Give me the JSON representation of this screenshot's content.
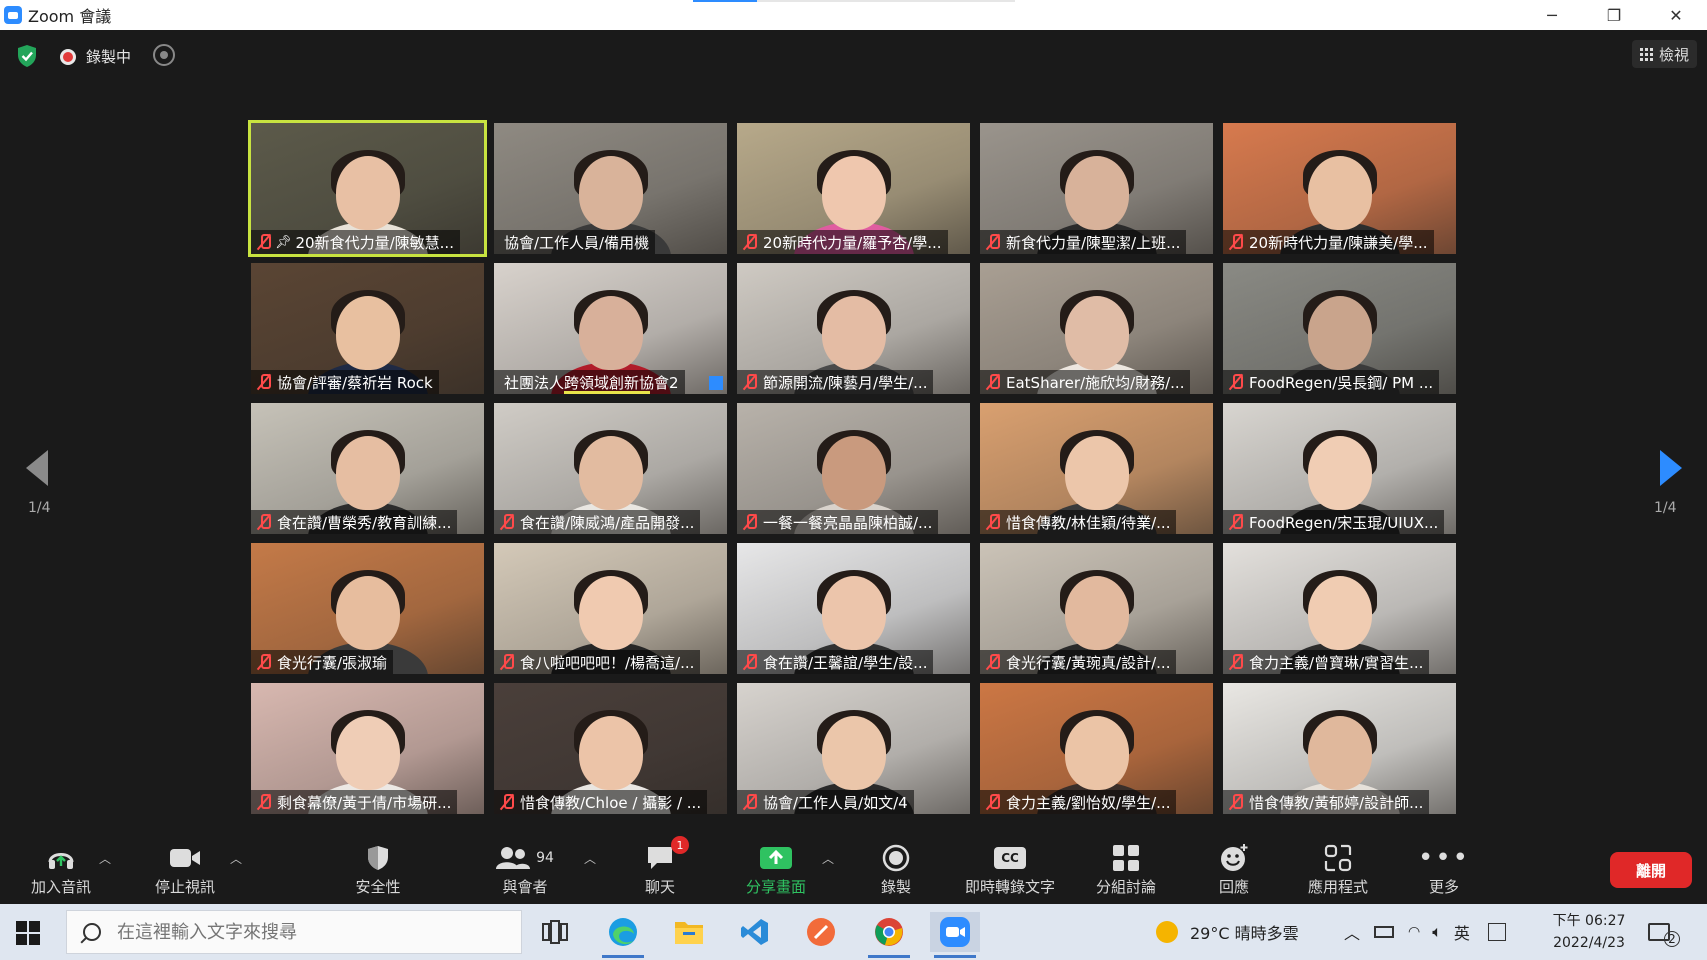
{
  "window": {
    "title": "Zoom 會議",
    "minimize": "─",
    "restore": "❐",
    "close": "✕"
  },
  "topbar": {
    "recording_label": "錄製中",
    "view_label": "檢視"
  },
  "gallery": {
    "page_left": "1/4",
    "page_right": "1/4",
    "tiles": [
      {
        "name": "20新食代力量/陳敏慧...",
        "bg": "#5c5a4a",
        "skin": "#e8c0a4",
        "shirt": "#e8e2d8"
      },
      {
        "name": "協會/工作人員/備用機",
        "bg": "#8f8a82",
        "skin": "#d9b39a",
        "shirt": "#3a3a3a"
      },
      {
        "name": "20新時代力量/羅予杏/學...",
        "bg": "#b7a98a",
        "skin": "#efc7ae",
        "shirt": "#e05ca0"
      },
      {
        "name": "新食代力量/陳聖潔/上班...",
        "bg": "#9a948c",
        "skin": "#d8b29a",
        "shirt": "#2b2b2b"
      },
      {
        "name": "20新時代力量/陳謙美/學...",
        "bg": "#d77a4e",
        "skin": "#e8c0a2",
        "shirt": "#2d2d2d"
      },
      {
        "name": "協會/評審/蔡祈岩 Rock",
        "bg": "#5a4534",
        "skin": "#e8c0a0",
        "shirt": "#1f2a44"
      },
      {
        "name": "社團法人跨領域創新協會2",
        "bg": "#d8d2cc",
        "skin": "#d8b09a",
        "shirt": "#b01c2a"
      },
      {
        "name": "節源開流/陳藝月/學生/...",
        "bg": "#cfcac3",
        "skin": "#e4bca4",
        "shirt": "#4a4a4a"
      },
      {
        "name": "EatSharer/施欣均/財務/...",
        "bg": "#a99f93",
        "skin": "#e0bca6",
        "shirt": "#ece6df"
      },
      {
        "name": "FoodRegen/吳長鋼/ PM ...",
        "bg": "#8a8a84",
        "skin": "#c9a48c",
        "shirt": "#3b3b3b"
      },
      {
        "name": "食在讚/曹榮秀/教育訓練...",
        "bg": "#c6c2b8",
        "skin": "#e6bea2",
        "shirt": "#2c2c2c"
      },
      {
        "name": "食在讚/陳威鴻/產品開發...",
        "bg": "#d0ccc6",
        "skin": "#e2bba0",
        "shirt": "#e9e6e1"
      },
      {
        "name": "一餐一餐亮晶晶陳柏誠/...",
        "bg": "#b8b2aa",
        "skin": "#c99a7e",
        "shirt": "#d9d3cc"
      },
      {
        "name": "惜食傳教/林佳穎/待業/...",
        "bg": "#d9a070",
        "skin": "#ecc6aa",
        "shirt": "#3a3a3a"
      },
      {
        "name": "FoodRegen/宋玉琨/UIUX...",
        "bg": "#d8d5d0",
        "skin": "#f0cdb4",
        "shirt": "#2b2b2b"
      },
      {
        "name": "食光行囊/張淑瑜",
        "bg": "#c47a48",
        "skin": "#e7bd9e",
        "shirt": "#3a3a3a"
      },
      {
        "name": "食八啦吧吧吧！/楊喬這/...",
        "bg": "#d4c9b8",
        "skin": "#f0cab0",
        "shirt": "#262626"
      },
      {
        "name": "食在讚/王馨誼/學生/設...",
        "bg": "#e7e7e8",
        "skin": "#ecc5ab",
        "shirt": "#303030"
      },
      {
        "name": "食光行囊/黃琬真/設計/...",
        "bg": "#cbc3b7",
        "skin": "#e2b99e",
        "shirt": "#2a2a2a"
      },
      {
        "name": "食力主義/曾寶琳/實習生...",
        "bg": "#e3e0dc",
        "skin": "#f0ccb2",
        "shirt": "#2c2c2c"
      },
      {
        "name": "剩食幕僚/黃于倩/市場研...",
        "bg": "#d8b8b0",
        "skin": "#efcdb6",
        "shirt": "#ece8e4"
      },
      {
        "name": "惜食傳教/Chloe / 攝影 / ...",
        "bg": "#4a3f3a",
        "skin": "#ecc4a8",
        "shirt": "#e9e6e2"
      },
      {
        "name": "協會/工作人員/如文/4",
        "bg": "#d7d3ce",
        "skin": "#ebc6aa",
        "shirt": "#2a2a2a"
      },
      {
        "name": "食力主義/劉怡奴/學生/...",
        "bg": "#cc7744",
        "skin": "#ebc4a6",
        "shirt": "#3a2f2a"
      },
      {
        "name": "惜食傳教/黃郁婷/設計師...",
        "bg": "#e9e7e3",
        "skin": "#e0b89c",
        "shirt": "#e6e1da"
      }
    ]
  },
  "toolbar": {
    "audio": "加入音訊",
    "video": "停止視訊",
    "security": "安全性",
    "participants": "與會者",
    "participant_count": "94",
    "chat": "聊天",
    "chat_badge": "1",
    "share": "分享畫面",
    "record": "錄製",
    "cc": "即時轉錄文字",
    "cc_icon_text": "CC",
    "breakout": "分組討論",
    "reactions": "回應",
    "apps": "應用程式",
    "more": "更多",
    "leave": "離開"
  },
  "taskbar": {
    "search_placeholder": "在這裡輸入文字來搜尋",
    "weather": "29°C  晴時多雲",
    "ime": "英",
    "time": "下午 06:27",
    "date": "2022/4/23",
    "notifications": "2"
  },
  "colors": {
    "accent": "#2d8cff",
    "share_green": "#2fc261",
    "leave_red": "#e02828",
    "active_speaker": "#c8e340",
    "muted_red": "#ff4a4a"
  }
}
